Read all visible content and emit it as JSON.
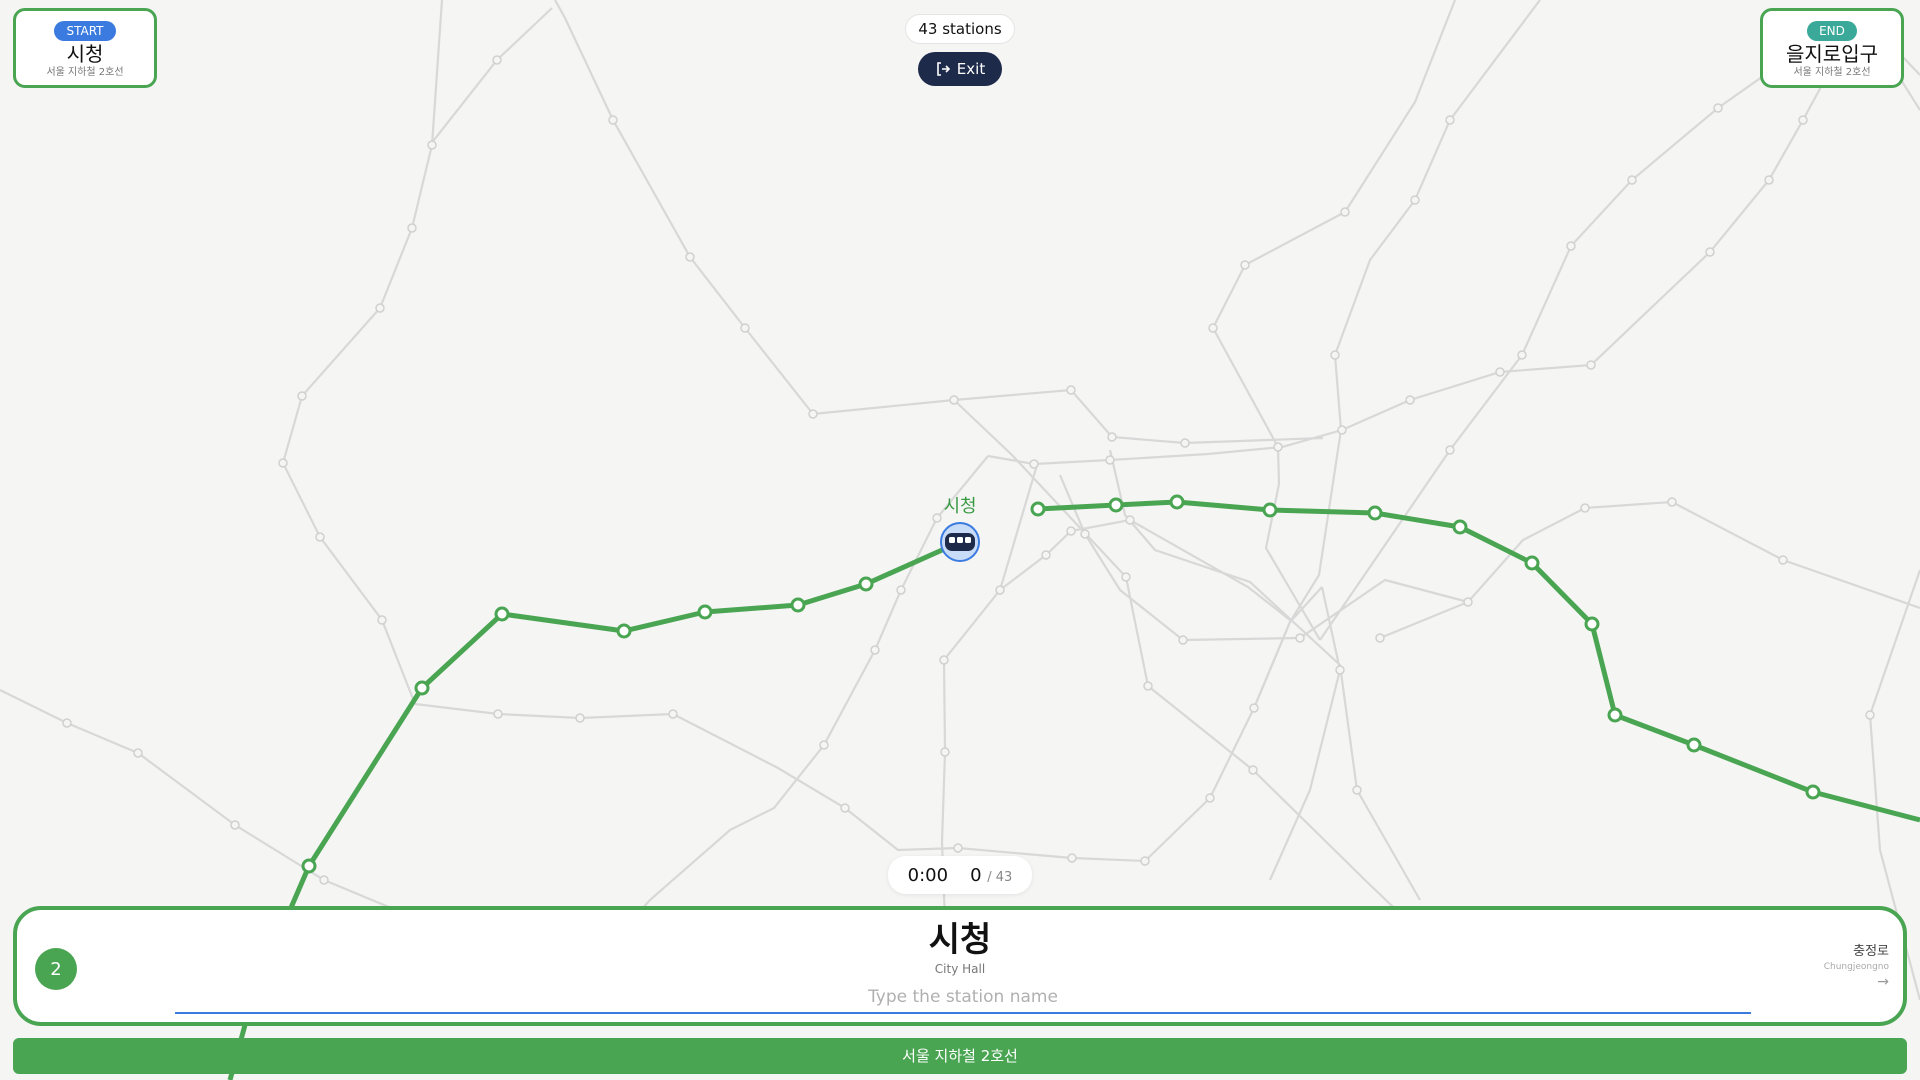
{
  "start": {
    "badge": "START",
    "station": "시청",
    "line": "서울 지하철 2호선"
  },
  "end": {
    "badge": "END",
    "station": "을지로입구",
    "line": "서울 지하철 2호선"
  },
  "header": {
    "station_count": "43 stations",
    "exit_label": "Exit"
  },
  "map": {
    "current_station_label": "시청",
    "route_color": "#4aa552",
    "background_line_color": "#d6d6d6"
  },
  "timer": {
    "time": "0:00",
    "progress": "0",
    "total": "/ 43"
  },
  "input_panel": {
    "line_number": "2",
    "station_ko": "시청",
    "station_en": "City Hall",
    "placeholder": "Type the station name",
    "next_station_ko": "충정로",
    "next_station_en": "Chungjeongno"
  },
  "line_bar": {
    "label": "서울 지하철 2호선"
  },
  "colors": {
    "accent": "#4aa552",
    "start_badge": "#3b7be0",
    "end_badge": "#3aa99a",
    "exit_button": "#1e2a4a"
  },
  "icons": {
    "exit": "exit-icon",
    "train": "train-icon",
    "next": "arrow-right-icon"
  }
}
